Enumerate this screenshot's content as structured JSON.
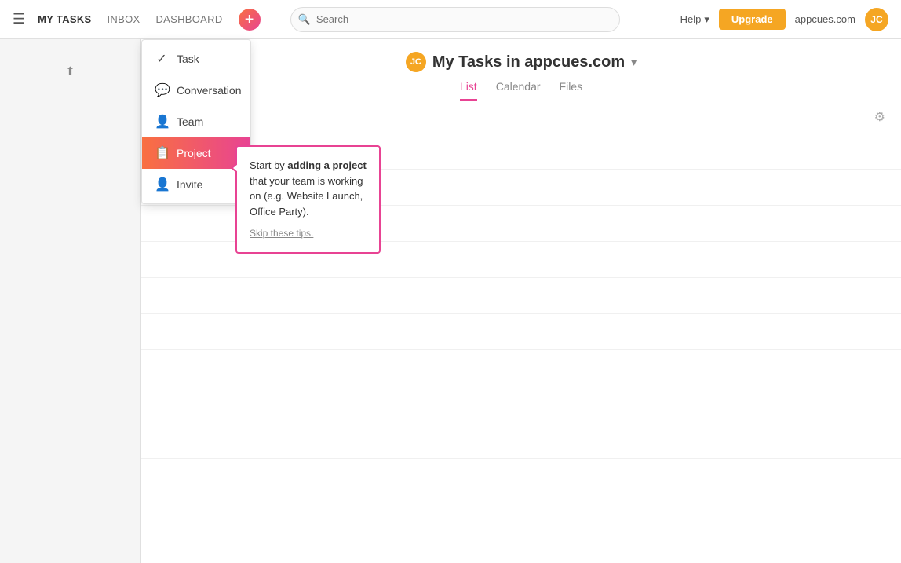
{
  "nav": {
    "my_tasks": "MY TASKS",
    "inbox": "INBOX",
    "dashboard": "DASHBOARD",
    "search_placeholder": "Search",
    "help_label": "Help",
    "upgrade_label": "Upgrade",
    "domain": "appcues.com",
    "avatar_initials": "JC"
  },
  "dropdown": {
    "items": [
      {
        "id": "task",
        "label": "Task",
        "icon": "✓"
      },
      {
        "id": "conversation",
        "label": "Conversation",
        "icon": "💬"
      },
      {
        "id": "team",
        "label": "Team",
        "icon": "👤"
      },
      {
        "id": "project",
        "label": "Project",
        "icon": "📋",
        "active": true
      },
      {
        "id": "invite",
        "label": "Invite",
        "icon": "👤"
      }
    ]
  },
  "page": {
    "title": "My Tasks in appcues.com",
    "avatar_initials": "JC",
    "tabs": [
      {
        "id": "list",
        "label": "List",
        "active": true
      },
      {
        "id": "calendar",
        "label": "Calendar"
      },
      {
        "id": "files",
        "label": "Files"
      }
    ]
  },
  "tooltip": {
    "text_intro": "Start by ",
    "text_bold": "adding a project",
    "text_body": " that your team is working on (e.g. Website Launch, Office Party).",
    "skip_label": "Skip these tips."
  },
  "tasks": {
    "rows": 9
  }
}
